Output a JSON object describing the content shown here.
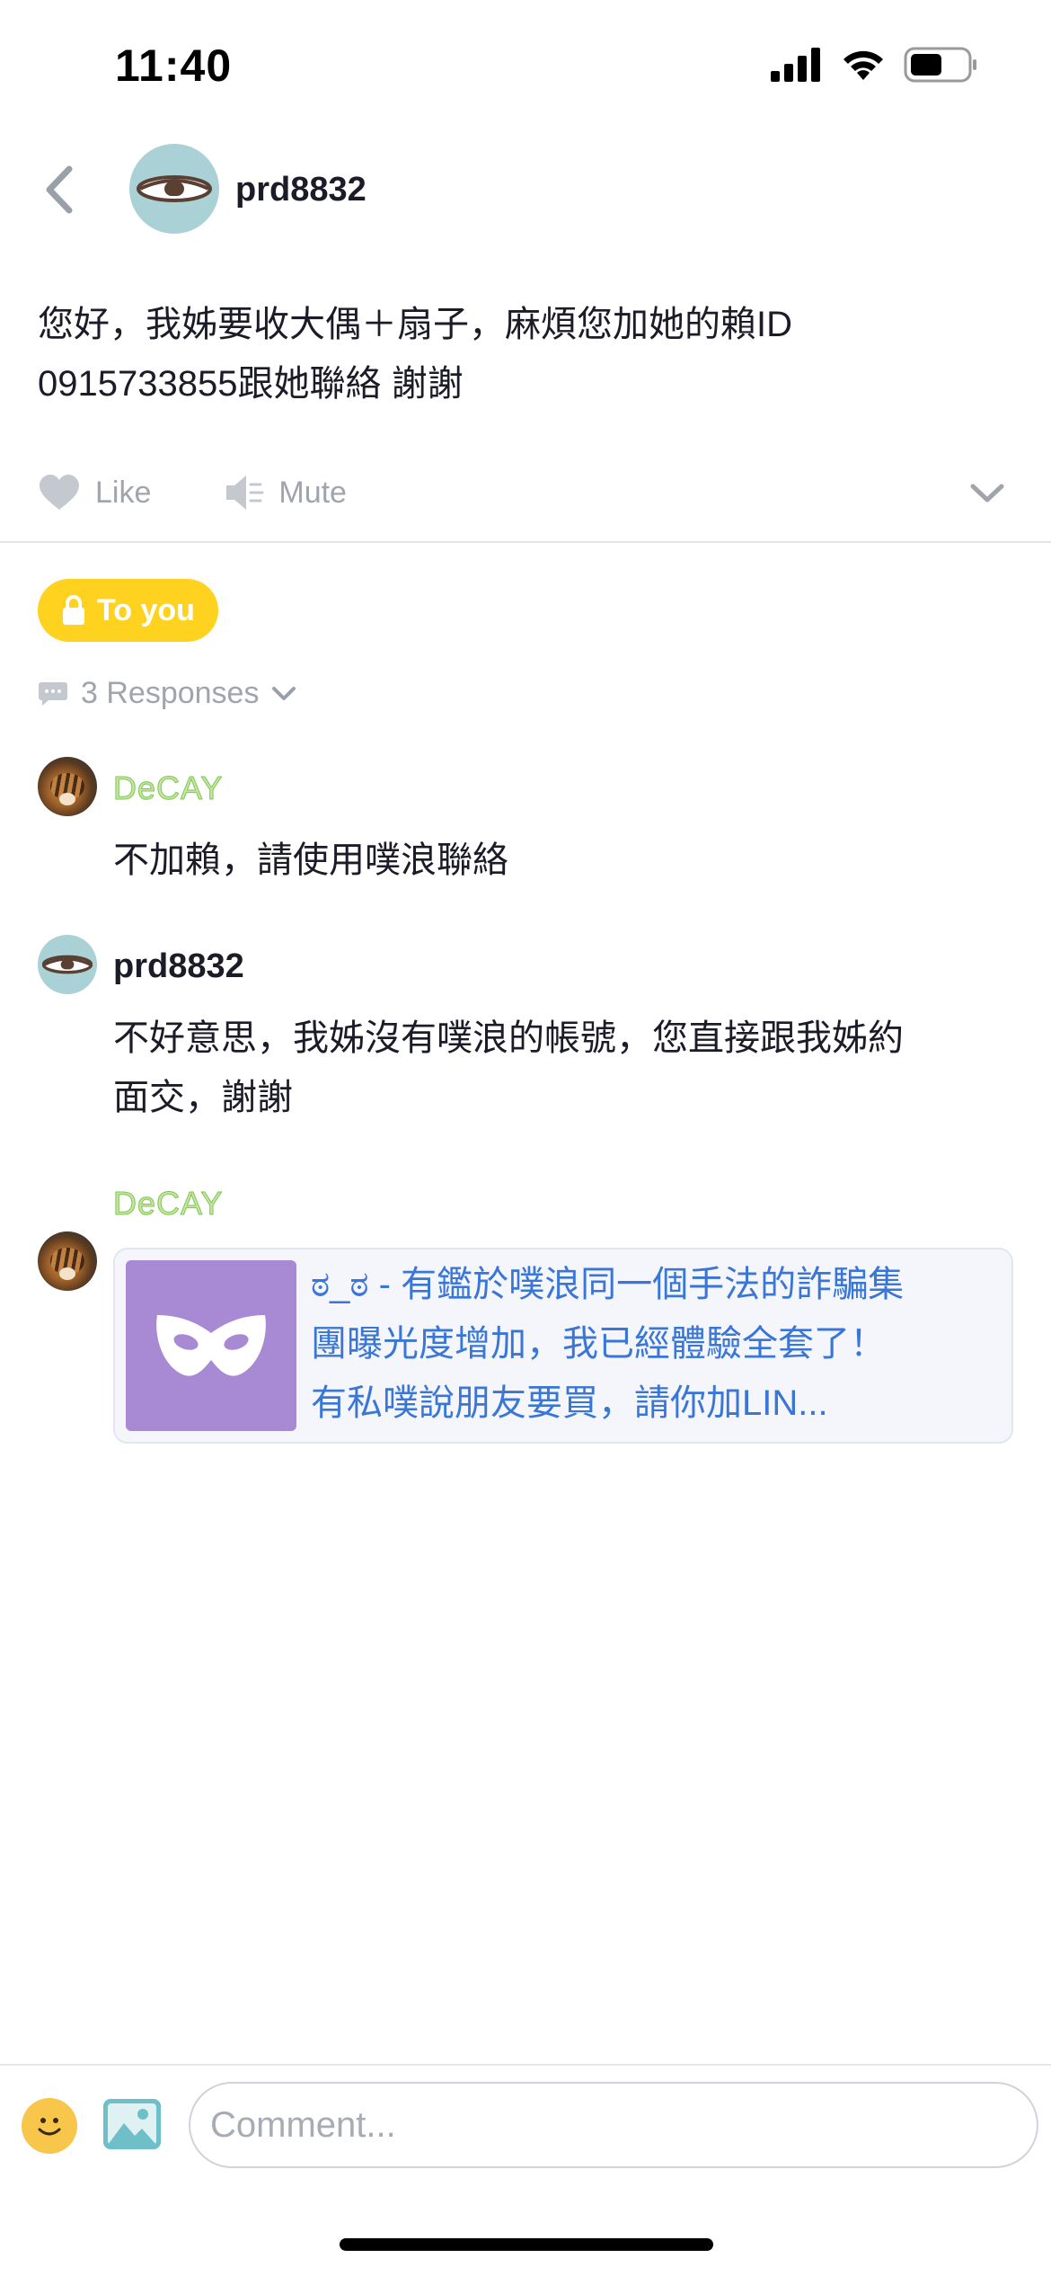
{
  "status": {
    "time": "11:40"
  },
  "header": {
    "username": "prd8832"
  },
  "post": {
    "text_line1": "您好，我姊要收大偶＋扇子，麻煩您加她的賴ID",
    "text_line2": "0915733855跟她聯絡 謝謝",
    "like_label": "Like",
    "mute_label": "Mute"
  },
  "privacy": {
    "label": "To you"
  },
  "responses": {
    "count_label": "3 Responses",
    "items": [
      {
        "user": "DeCAY",
        "text": "不加賴，請使用噗浪聯絡"
      },
      {
        "user": "prd8832",
        "text_line1": "不好意思，我姊沒有噗浪的帳號，您直接跟我姊約",
        "text_line2": "面交，謝謝"
      },
      {
        "user": "DeCAY",
        "link": {
          "line1": "ಠ_ಠ - 有鑑於噗浪同一個手法的詐騙集",
          "line2": "團曝光度增加，我已經體驗全套了！",
          "line3": "有私噗說朋友要買，請你加LIN..."
        }
      }
    ]
  },
  "comment": {
    "placeholder": "Comment..."
  },
  "colors": {
    "accent_yellow": "#ffd21f",
    "link_blue": "#3a76d6",
    "username_green": "#7fc45a",
    "avatar_teal": "#a9d1d6"
  }
}
